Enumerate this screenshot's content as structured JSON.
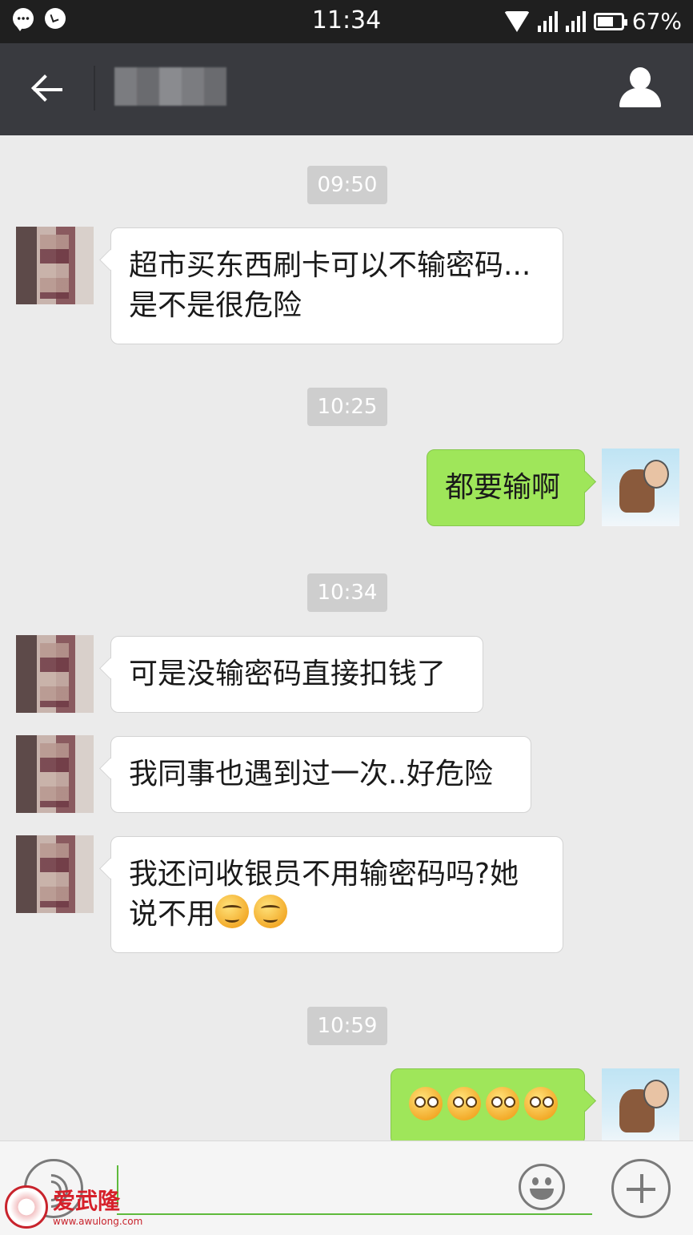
{
  "status_bar": {
    "time": "11:34",
    "battery": "67%",
    "battery_level": 0.67,
    "icons": [
      "message-bubble-icon",
      "alarm-icon",
      "wifi-icon",
      "signal-icon",
      "battery-icon"
    ]
  },
  "title_bar": {
    "chat_name": "",
    "icons": [
      "back-arrow-icon",
      "profile-icon"
    ]
  },
  "messages": [
    {
      "type": "time",
      "text": "09:50"
    },
    {
      "type": "received",
      "text": "超市买东西刷卡可以不输密码...是不是很危险"
    },
    {
      "type": "time",
      "text": "10:25"
    },
    {
      "type": "sent",
      "text": "都要输啊"
    },
    {
      "type": "time",
      "text": "10:34"
    },
    {
      "type": "received",
      "text": "可是没输密码直接扣钱了"
    },
    {
      "type": "received",
      "text": "我同事也遇到过一次..好危险"
    },
    {
      "type": "received",
      "text": "我还问收银员不用输密码吗?她说不用",
      "emoji": [
        "smirk-emoji",
        "smirk-emoji"
      ]
    },
    {
      "type": "time",
      "text": "10:59"
    },
    {
      "type": "sent",
      "text": "",
      "emoji": [
        "pleading-emoji",
        "pleading-emoji",
        "pleading-emoji",
        "pleading-emoji"
      ]
    }
  ],
  "input_bar": {
    "value": "",
    "icons": [
      "voice-icon",
      "emoji-icon",
      "plus-icon"
    ]
  },
  "watermark": {
    "name": "爱武隆",
    "url": "www.awulong.com"
  },
  "colors": {
    "status_bar": "#1f1f1f",
    "title_bar": "#393a3f",
    "chat_background": "#ebebeb",
    "sent_bubble": "#9fe65a",
    "received_bubble": "#ffffff",
    "input_underline": "#5fba3c"
  }
}
